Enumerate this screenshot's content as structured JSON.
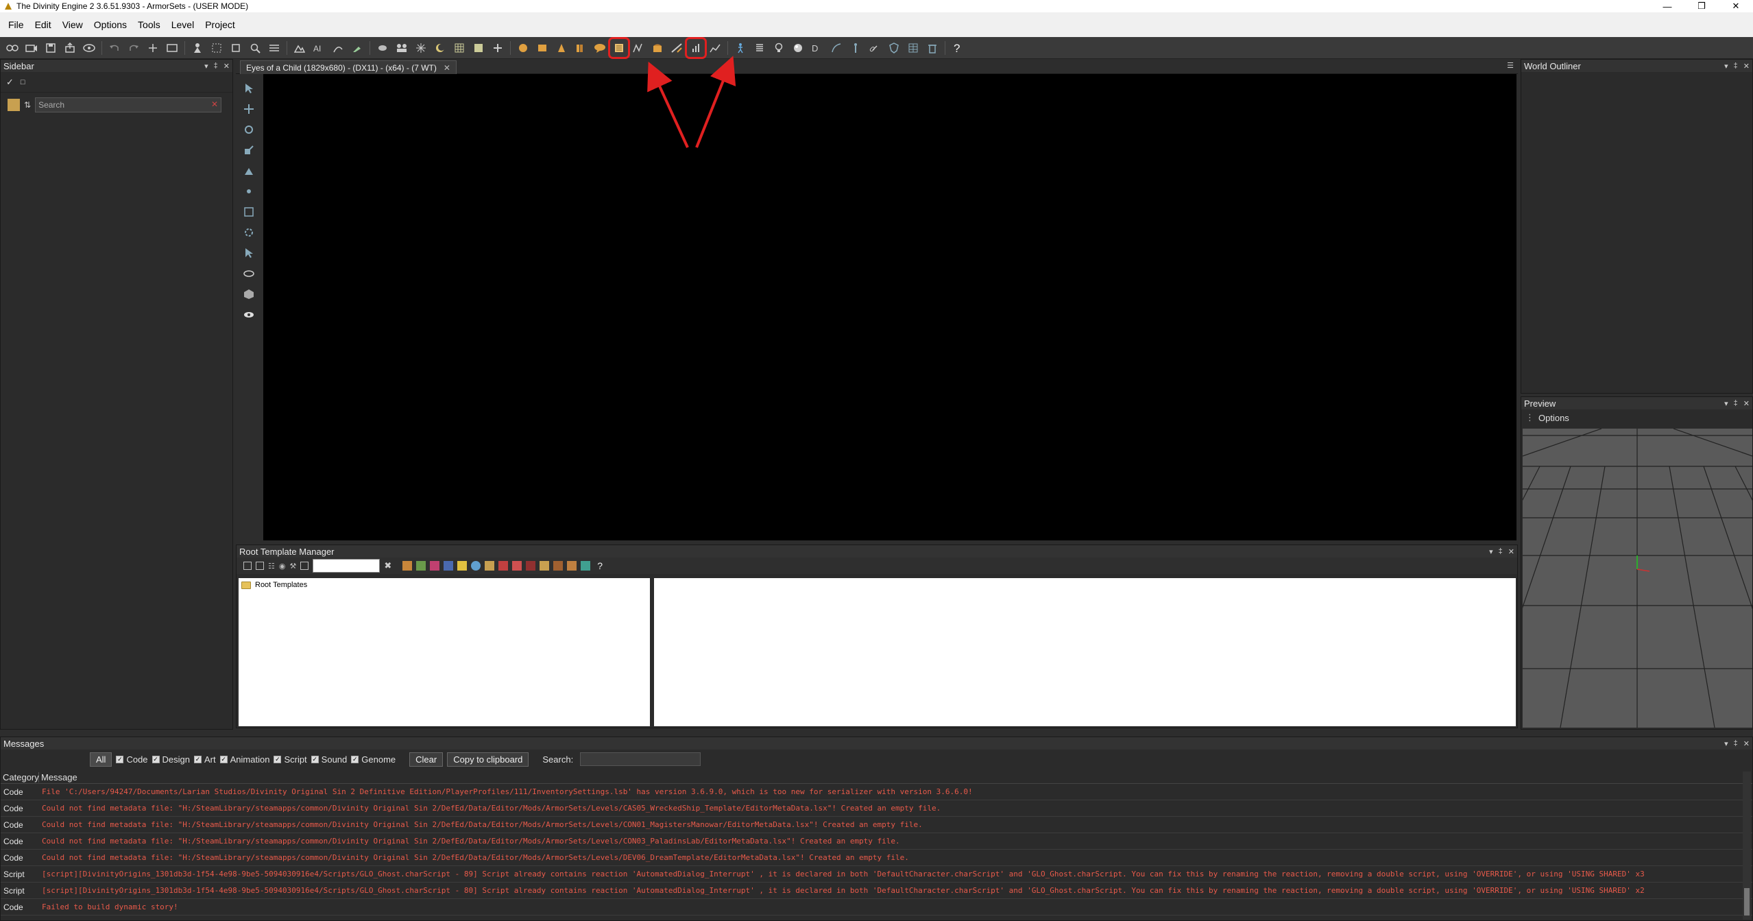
{
  "window": {
    "title": "The Divinity Engine 2 3.6.51.9303 - ArmorSets - (USER MODE)",
    "controls": [
      "—",
      "❒",
      "✕"
    ]
  },
  "menu": [
    "File",
    "Edit",
    "View",
    "Options",
    "Tools",
    "Level",
    "Project"
  ],
  "sidebar": {
    "title": "Sidebar",
    "search_placeholder": "Search"
  },
  "viewport": {
    "tab_label": "Eyes of a Child (1829x680) - (DX11) - (x64) - (7 WT)",
    "close": "✕"
  },
  "root_template_manager": {
    "title": "Root Template Manager",
    "tree_root": "Root Templates",
    "help": "?"
  },
  "world_outliner": {
    "title": "World Outliner"
  },
  "preview": {
    "title": "Preview",
    "options_label": "Options"
  },
  "messages": {
    "title": "Messages",
    "all_label": "All",
    "filters": [
      "Code",
      "Design",
      "Art",
      "Animation",
      "Script",
      "Sound",
      "Genome"
    ],
    "clear_label": "Clear",
    "copy_label": "Copy to clipboard",
    "search_label": "Search:",
    "columns": [
      "Category",
      "Message"
    ],
    "rows": [
      {
        "category": "Code",
        "message": "File 'C:/Users/94247/Documents/Larian Studios/Divinity Original Sin 2 Definitive Edition/PlayerProfiles/111/InventorySettings.lsb' has version 3.6.9.0, which is too new for serializer with version 3.6.6.0!"
      },
      {
        "category": "Code",
        "message": "Could not find metadata file: \"H:/SteamLibrary/steamapps/common/Divinity Original Sin 2/DefEd/Data/Editor/Mods/ArmorSets/Levels/CAS05_WreckedShip_Template/EditorMetaData.lsx\"! Created an empty file."
      },
      {
        "category": "Code",
        "message": "Could not find metadata file: \"H:/SteamLibrary/steamapps/common/Divinity Original Sin 2/DefEd/Data/Editor/Mods/ArmorSets/Levels/CON01_MagistersManowar/EditorMetaData.lsx\"! Created an empty file."
      },
      {
        "category": "Code",
        "message": "Could not find metadata file: \"H:/SteamLibrary/steamapps/common/Divinity Original Sin 2/DefEd/Data/Editor/Mods/ArmorSets/Levels/CON03_PaladinsLab/EditorMetaData.lsx\"! Created an empty file."
      },
      {
        "category": "Code",
        "message": "Could not find metadata file: \"H:/SteamLibrary/steamapps/common/Divinity Original Sin 2/DefEd/Data/Editor/Mods/ArmorSets/Levels/DEV06_DreamTemplate/EditorMetaData.lsx\"! Created an empty file."
      },
      {
        "category": "Script",
        "message": "[script][DivinityOrigins_1301db3d-1f54-4e98-9be5-5094030916e4/Scripts/GLO_Ghost.charScript - 89] Script already contains reaction 'AutomatedDialog_Interrupt' , it is declared in both 'DefaultCharacter.charScript' and 'GLO_Ghost.charScript. You can fix this by renaming the reaction, removing a double script, using 'OVERRIDE', or using 'USING SHARED' x3"
      },
      {
        "category": "Script",
        "message": "[script][DivinityOrigins_1301db3d-1f54-4e98-9be5-5094030916e4/Scripts/GLO_Ghost.charScript - 80] Script already contains reaction 'AutomatedDialog_Interrupt' , it is declared in both 'DefaultCharacter.charScript' and 'GLO_Ghost.charScript. You can fix this by renaming the reaction, removing a double script, using 'OVERRIDE', or using 'USING SHARED' x2"
      },
      {
        "category": "Code",
        "message": "Failed to build dynamic story!"
      }
    ]
  },
  "colors": {
    "highlight": "#e02020",
    "error_text": "#e85a4a",
    "viewport_bg": "#000000",
    "preview_bg": "#5a5a5a"
  }
}
